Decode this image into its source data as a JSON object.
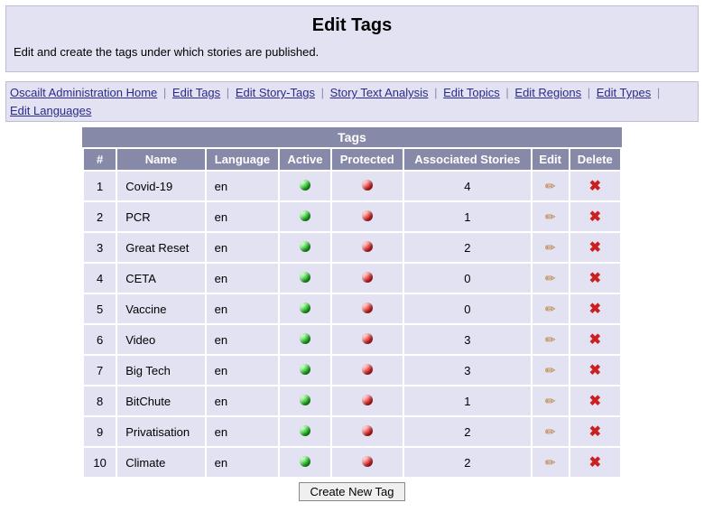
{
  "header": {
    "title": "Edit Tags",
    "description": "Edit and create the tags under which stories are published."
  },
  "nav": {
    "items": [
      "Oscailt Administration Home",
      "Edit Tags",
      "Edit Story-Tags",
      "Story Text Analysis",
      "Edit Topics",
      "Edit Regions",
      "Edit Types",
      "Edit Languages"
    ]
  },
  "table": {
    "caption": "Tags",
    "columns": [
      "#",
      "Name",
      "Language",
      "Active",
      "Protected",
      "Associated Stories",
      "Edit",
      "Delete"
    ],
    "rows": [
      {
        "num": "1",
        "name": "Covid-19",
        "lang": "en",
        "active": true,
        "protected": false,
        "stories": "4"
      },
      {
        "num": "2",
        "name": "PCR",
        "lang": "en",
        "active": true,
        "protected": false,
        "stories": "1"
      },
      {
        "num": "3",
        "name": "Great Reset",
        "lang": "en",
        "active": true,
        "protected": false,
        "stories": "2"
      },
      {
        "num": "4",
        "name": "CETA",
        "lang": "en",
        "active": true,
        "protected": false,
        "stories": "0"
      },
      {
        "num": "5",
        "name": "Vaccine",
        "lang": "en",
        "active": true,
        "protected": false,
        "stories": "0"
      },
      {
        "num": "6",
        "name": "Video",
        "lang": "en",
        "active": true,
        "protected": false,
        "stories": "3"
      },
      {
        "num": "7",
        "name": "Big Tech",
        "lang": "en",
        "active": true,
        "protected": false,
        "stories": "3"
      },
      {
        "num": "8",
        "name": "BitChute",
        "lang": "en",
        "active": true,
        "protected": false,
        "stories": "1"
      },
      {
        "num": "9",
        "name": "Privatisation",
        "lang": "en",
        "active": true,
        "protected": false,
        "stories": "2"
      },
      {
        "num": "10",
        "name": "Climate",
        "lang": "en",
        "active": true,
        "protected": false,
        "stories": "2"
      }
    ]
  },
  "buttons": {
    "create": "Create New Tag"
  }
}
